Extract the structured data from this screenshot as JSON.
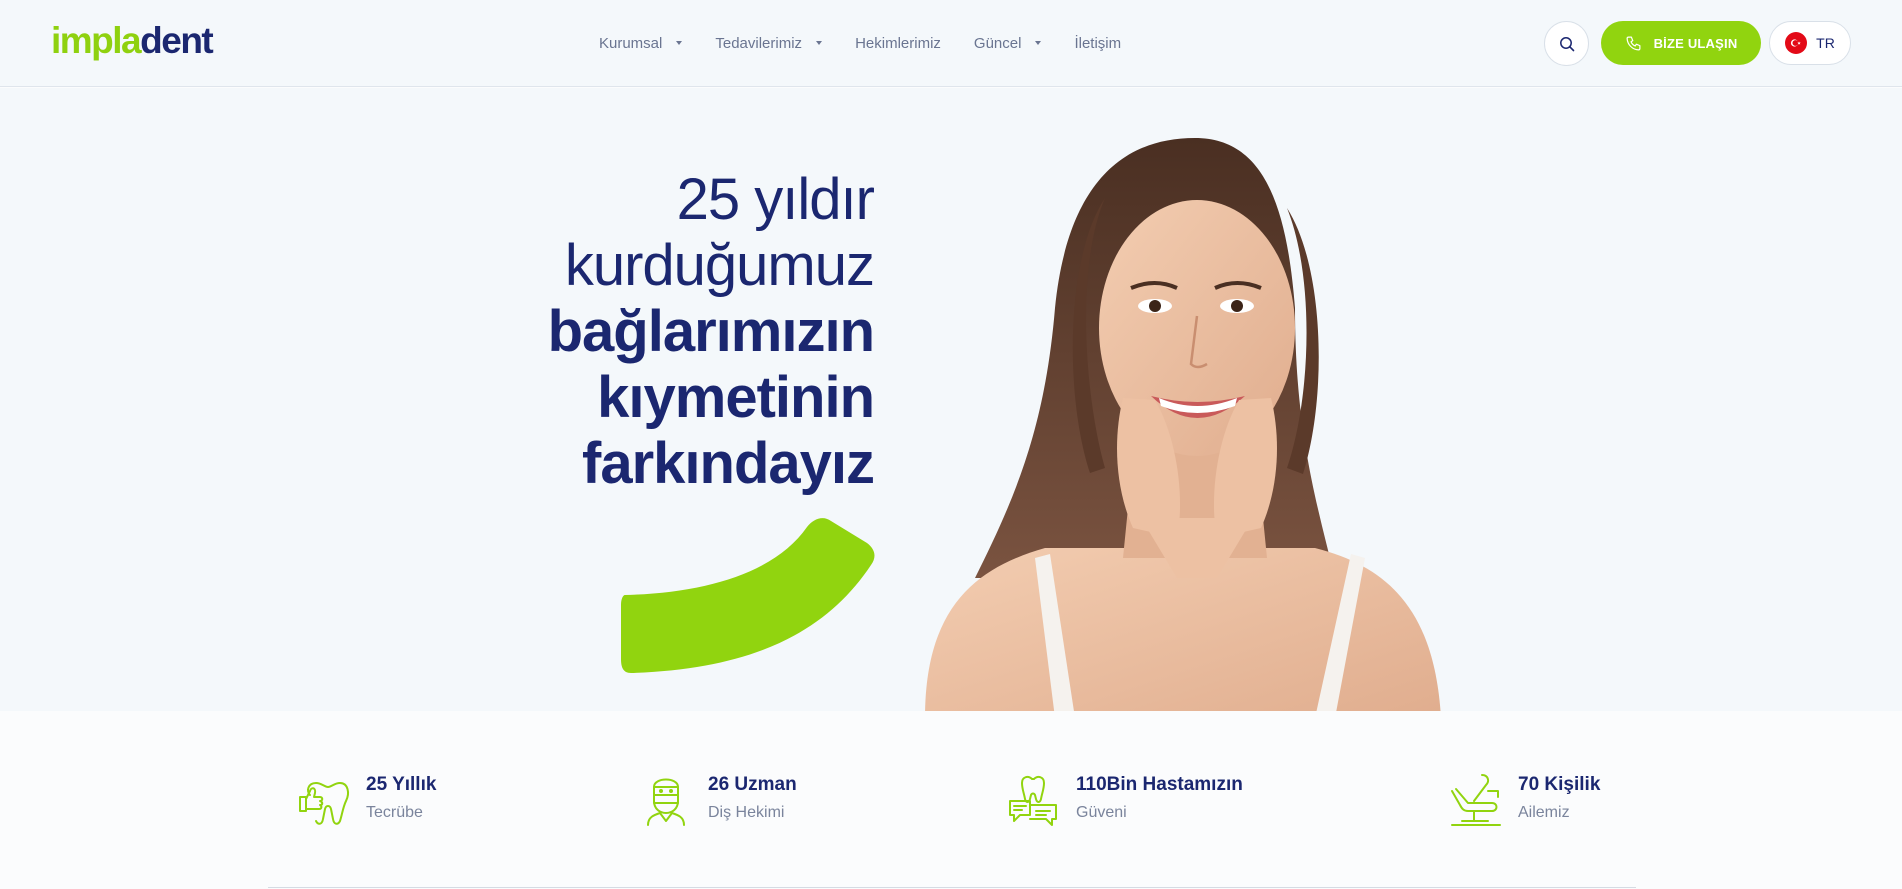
{
  "header": {
    "logo": {
      "part1": "impla",
      "part2": "dent"
    },
    "nav": [
      {
        "label": "Kurumsal",
        "has_dropdown": true
      },
      {
        "label": "Tedavilerimiz",
        "has_dropdown": true
      },
      {
        "label": "Hekimlerimiz",
        "has_dropdown": false
      },
      {
        "label": "Güncel",
        "has_dropdown": true
      },
      {
        "label": "İletişim",
        "has_dropdown": false
      }
    ],
    "search_icon": "search-icon",
    "cta_label": "BİZE ULAŞIN",
    "cta_icon": "phone-icon",
    "language": "TR",
    "language_icon": "turkey-flag-icon"
  },
  "hero": {
    "line1": "25 yıldır",
    "line2": "kurduğumuz",
    "line3": "bağlarımızın",
    "line4": "kıymetinin",
    "line5": "farkındayız"
  },
  "stats": [
    {
      "title": "25 Yıllık",
      "subtitle": "Tecrübe",
      "icon": "tooth-thumbs-up-icon"
    },
    {
      "title": "26 Uzman",
      "subtitle": "Diş Hekimi",
      "icon": "dentist-icon"
    },
    {
      "title": "110Bin Hastamızın",
      "subtitle": "Güveni",
      "icon": "tooth-chat-icon"
    },
    {
      "title": "70 Kişilik",
      "subtitle": "Ailemiz",
      "icon": "dental-chair-icon"
    }
  ],
  "colors": {
    "brand_green": "#91d40f",
    "brand_navy": "#1b2770",
    "hero_bg": "#f4f8fb",
    "muted_text": "#6a7591"
  }
}
